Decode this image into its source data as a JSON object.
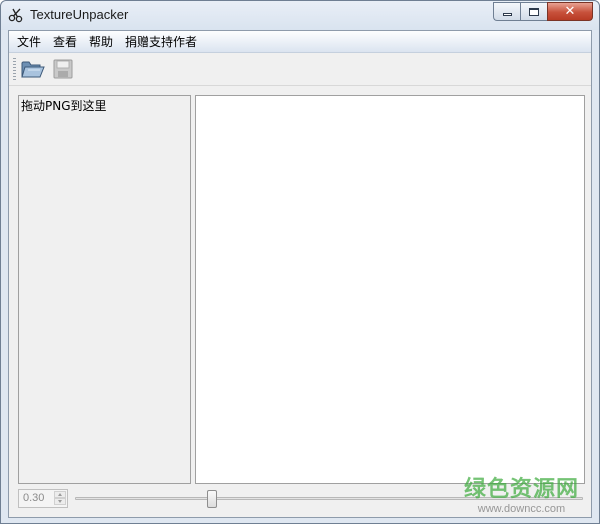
{
  "window": {
    "title": "TextureUnpacker",
    "icons": {
      "app": "scissors-icon",
      "minimize": "minimize-icon",
      "maximize": "maximize-icon",
      "close": "close-icon"
    },
    "close_glyph": "✕"
  },
  "menu": {
    "items": [
      {
        "label": "文件"
      },
      {
        "label": "查看"
      },
      {
        "label": "帮助"
      },
      {
        "label": "捐赠支持作者"
      }
    ]
  },
  "toolbar": {
    "buttons": [
      {
        "icon": "open-folder-icon",
        "enabled": true
      },
      {
        "icon": "save-disk-icon",
        "enabled": false
      }
    ]
  },
  "left_panel": {
    "hint": "拖动PNG到这里"
  },
  "scale": {
    "value": "0.30",
    "slider_fraction": 0.27
  },
  "watermark": {
    "title": "绿色资源网",
    "url": "www.downcc.com"
  },
  "colors": {
    "close_button": "#c7513b",
    "menubar": "#dbe4f0",
    "watermark_green": "#3aaa3a"
  }
}
